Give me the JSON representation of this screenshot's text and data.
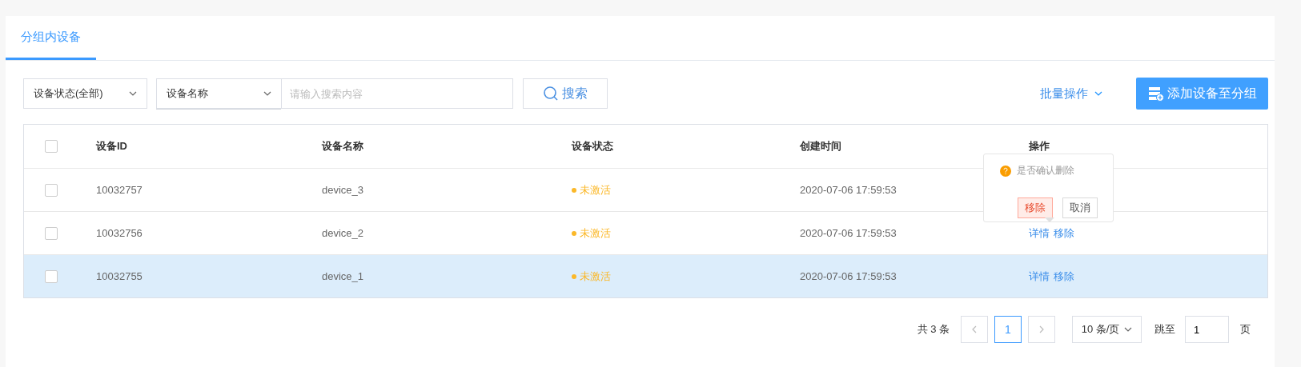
{
  "tabs": [
    {
      "label": "分组内设备",
      "selected": true
    }
  ],
  "filters": {
    "status_select": "设备状态(全部)",
    "field_select": "设备名称",
    "search": {
      "placeholder": "请输入搜索内容"
    },
    "search_button": "搜索",
    "batch_menu": "批量操作",
    "add_button": "添加设备至分组"
  },
  "table": {
    "all_checked": false,
    "columns": [
      "设备ID",
      "设备名称",
      "设备状态",
      "创建时间",
      "操作"
    ],
    "rows": [
      {
        "checked": false,
        "selected": false,
        "id": "10032757",
        "name": "device_3",
        "status": {
          "label": "未激活",
          "color": "#fbb829"
        },
        "created": "2020-07-06 17:59:53",
        "actions": []
      },
      {
        "checked": false,
        "selected": false,
        "id": "10032756",
        "name": "device_2",
        "status": {
          "label": "未激活",
          "color": "#fbb829"
        },
        "created": "2020-07-06 17:59:53",
        "actions": [
          "详情",
          "移除"
        ]
      },
      {
        "checked": false,
        "selected": true,
        "id": "10032755",
        "name": "device_1",
        "status": {
          "label": "未激活",
          "color": "#fbb829"
        },
        "created": "2020-07-06 17:59:53",
        "actions": [
          "详情",
          "移除"
        ]
      }
    ]
  },
  "popconfirm": {
    "message": "是否确认删除",
    "confirm": "移除",
    "cancel": "取消"
  },
  "pagination": {
    "total": "共 3 条",
    "pages": [
      {
        "label": "1",
        "selected": true
      }
    ],
    "page_size": "10 条/页",
    "jump_label": "跳至",
    "jump_value": "1",
    "page_suffix": "页"
  }
}
